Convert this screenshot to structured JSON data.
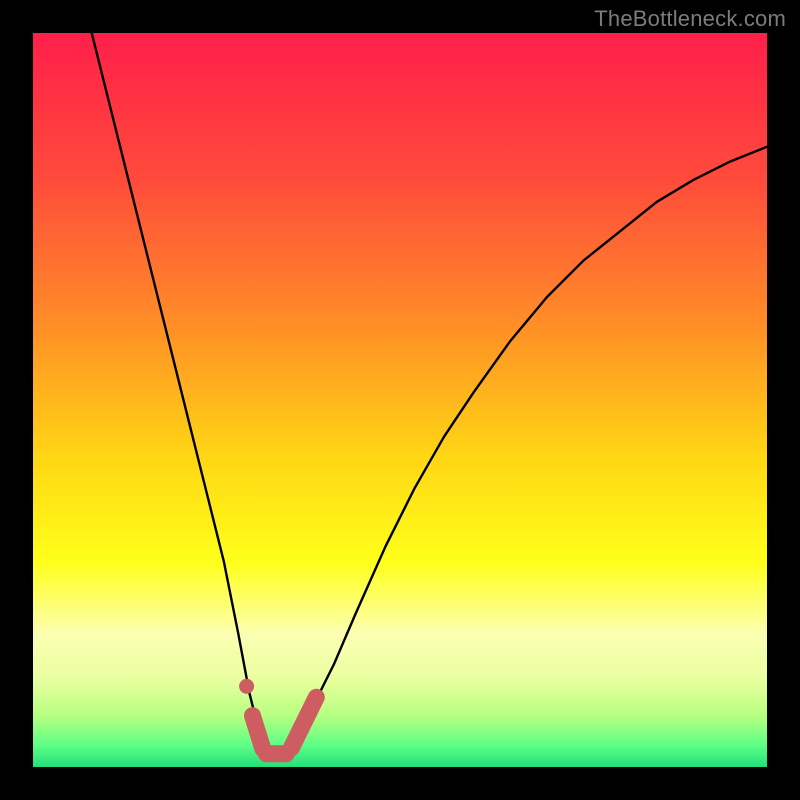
{
  "watermark": "TheBottleneck.com",
  "colors": {
    "black": "#000000",
    "curve": "#000000",
    "marker": "#cd5d61",
    "watermark": "#7c7c7c"
  },
  "chart_data": {
    "type": "line",
    "title": "",
    "xlabel": "",
    "ylabel": "",
    "xlim": [
      0,
      100
    ],
    "ylim": [
      0,
      100
    ],
    "gradient_stops": [
      {
        "offset": 0.0,
        "color": "#ff1f4a"
      },
      {
        "offset": 0.2,
        "color": "#ff4b3b"
      },
      {
        "offset": 0.4,
        "color": "#ff8f26"
      },
      {
        "offset": 0.58,
        "color": "#ffd714"
      },
      {
        "offset": 0.72,
        "color": "#ffff1a"
      },
      {
        "offset": 0.82,
        "color": "#fbffb2"
      },
      {
        "offset": 0.88,
        "color": "#eaffa0"
      },
      {
        "offset": 0.93,
        "color": "#b6ff80"
      },
      {
        "offset": 0.97,
        "color": "#5eff86"
      },
      {
        "offset": 1.0,
        "color": "#22e079"
      }
    ],
    "series": [
      {
        "name": "bottleneck-curve",
        "x": [
          8,
          10,
          12,
          14,
          16,
          18,
          20,
          22,
          24,
          26,
          28,
          29.5,
          31,
          32.5,
          34,
          36,
          38,
          41,
          44,
          48,
          52,
          56,
          60,
          65,
          70,
          75,
          80,
          85,
          90,
          95,
          100
        ],
        "y": [
          100,
          92,
          84,
          76,
          68,
          60,
          52,
          44,
          36,
          28,
          18,
          10,
          4,
          2,
          2,
          4,
          8,
          14,
          21,
          30,
          38,
          45,
          51,
          58,
          64,
          69,
          73,
          77,
          80,
          82.5,
          84.5
        ]
      }
    ],
    "markers": [
      {
        "shape": "dot",
        "x": 29.1,
        "y": 11.0
      },
      {
        "shape": "rounded-segment",
        "start": {
          "x": 29.9,
          "y": 7.0
        },
        "end": {
          "x": 31.3,
          "y": 2.5
        }
      },
      {
        "shape": "rounded-segment",
        "start": {
          "x": 31.8,
          "y": 1.8
        },
        "end": {
          "x": 34.5,
          "y": 1.8
        }
      },
      {
        "shape": "rounded-segment",
        "start": {
          "x": 35.2,
          "y": 2.6
        },
        "end": {
          "x": 38.6,
          "y": 9.5
        }
      }
    ]
  }
}
